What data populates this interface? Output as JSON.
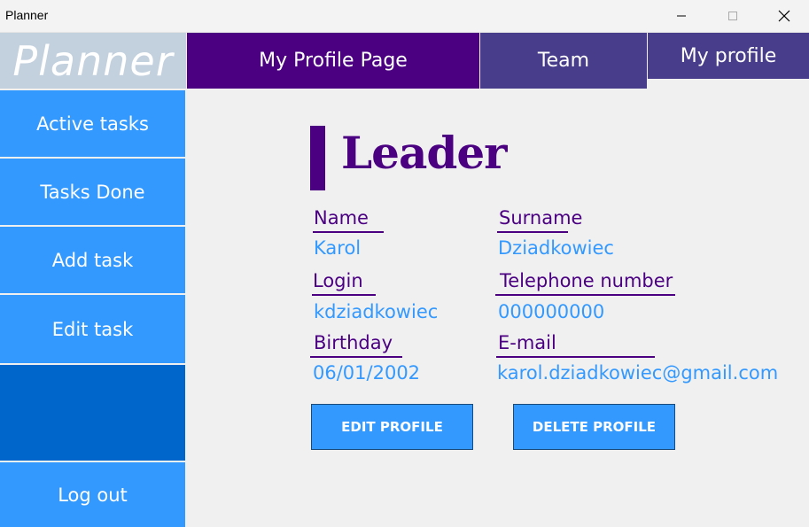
{
  "window": {
    "title": "Planner"
  },
  "logo": {
    "text": "Planner"
  },
  "tabs": [
    {
      "label": "My Profile Page"
    },
    {
      "label": "Team"
    },
    {
      "label": "My profile"
    }
  ],
  "sidebar": {
    "items": [
      {
        "label": "Active tasks"
      },
      {
        "label": "Tasks Done"
      },
      {
        "label": "Add task"
      },
      {
        "label": "Edit task"
      },
      {
        "label": "Log out"
      }
    ]
  },
  "profile": {
    "role": "Leader",
    "fields": {
      "name": {
        "label": "Name",
        "value": "Karol"
      },
      "surname": {
        "label": "Surname",
        "value": "Dziadkowiec"
      },
      "login": {
        "label": "Login",
        "value": "kdziadkowiec"
      },
      "telephone": {
        "label": "Telephone number",
        "value": "000000000"
      },
      "birthday": {
        "label": "Birthday",
        "value": "06/01/2002"
      },
      "email": {
        "label": "E-mail",
        "value": "karol.dziadkowiec@gmail.com"
      }
    },
    "buttons": {
      "edit": "EDIT PROFILE",
      "delete": "DELETE PROFILE"
    }
  },
  "colors": {
    "purple": "#4b0082",
    "slate_blue": "#483d8b",
    "blue": "#3399ff",
    "dark_blue": "#0066cc",
    "logo_bg": "#c3d0de"
  }
}
